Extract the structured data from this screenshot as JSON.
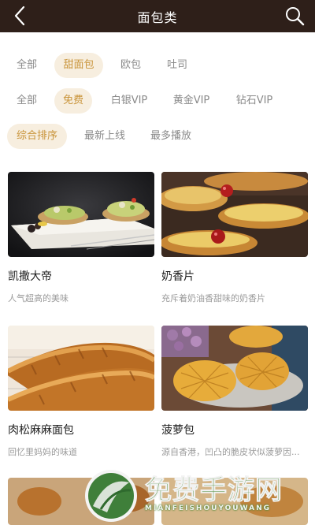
{
  "header": {
    "title": "面包类"
  },
  "filters": {
    "category": [
      "全部",
      "甜面包",
      "欧包",
      "吐司"
    ],
    "price": [
      "全部",
      "免费",
      "白银VIP",
      "黄金VIP",
      "钻石VIP"
    ],
    "sort": [
      "综合排序",
      "最新上线",
      "最多播放"
    ]
  },
  "selected": {
    "category": "甜面包",
    "price": "免费",
    "sort": "综合排序"
  },
  "items": [
    {
      "name": "凯撒大帝",
      "desc": "人气超高的美味"
    },
    {
      "name": "奶香片",
      "desc": "充斥着奶油香甜味的奶香片"
    },
    {
      "name": "肉松麻麻面包",
      "desc": "回忆里妈妈的味道"
    },
    {
      "name": "菠萝包",
      "desc": "源自香港，凹凸的脆皮状似菠萝因..."
    }
  ],
  "watermark": {
    "title": "免费手游网",
    "subtitle": "MIANFEISHOUYOUWANG"
  },
  "colors": {
    "header": "#2e1f19",
    "accent": "#c9943a",
    "chip_bg": "#f7eedf"
  }
}
